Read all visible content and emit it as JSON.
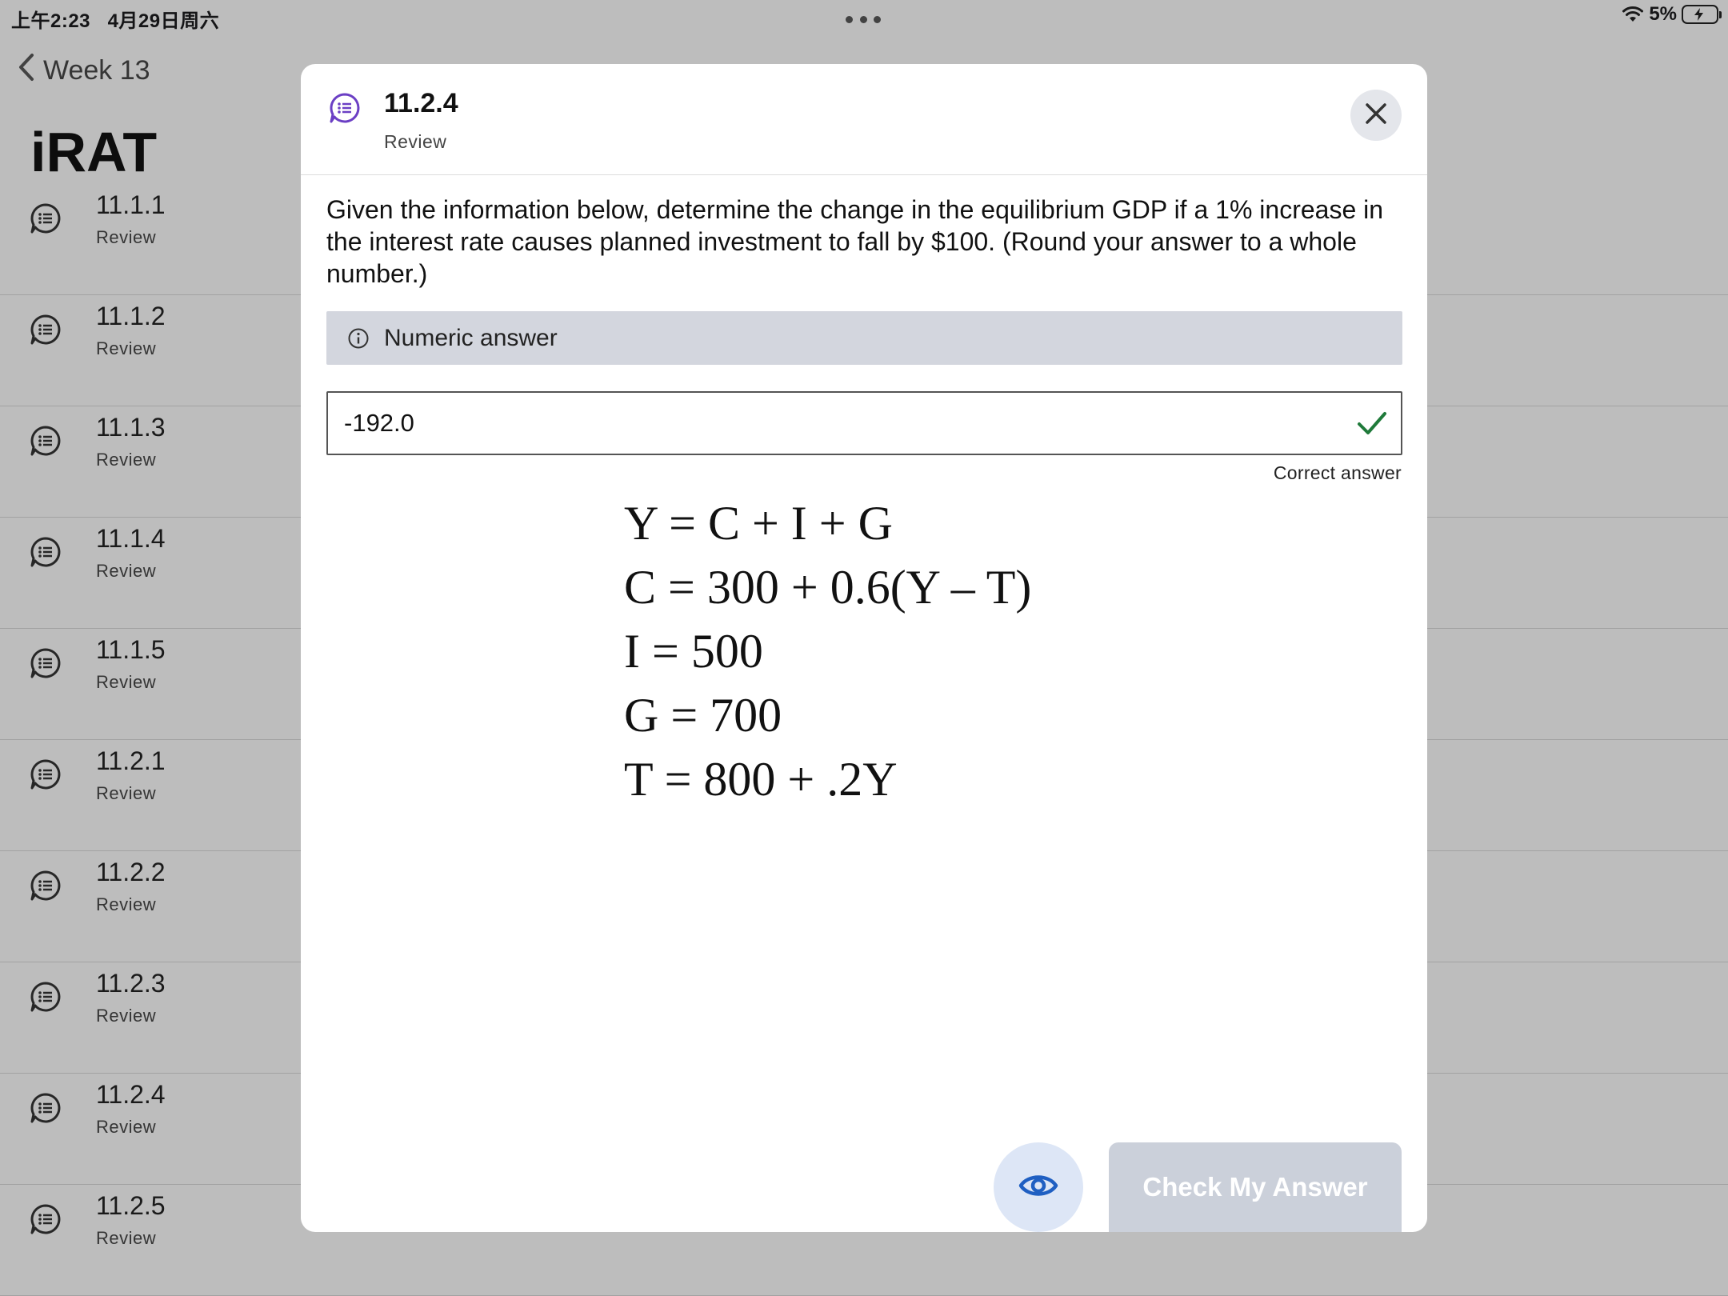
{
  "status_bar": {
    "time": "上午2:23",
    "date": "4月29日周六",
    "battery": "5%"
  },
  "nav": {
    "back_label": "Week 13",
    "page_title": "iRAT"
  },
  "list": {
    "items": [
      {
        "title": "11.1.1",
        "subtitle": "Review"
      },
      {
        "title": "11.1.2",
        "subtitle": "Review"
      },
      {
        "title": "11.1.3",
        "subtitle": "Review"
      },
      {
        "title": "11.1.4",
        "subtitle": "Review"
      },
      {
        "title": "11.1.5",
        "subtitle": "Review"
      },
      {
        "title": "11.2.1",
        "subtitle": "Review"
      },
      {
        "title": "11.2.2",
        "subtitle": "Review"
      },
      {
        "title": "11.2.3",
        "subtitle": "Review"
      },
      {
        "title": "11.2.4",
        "subtitle": "Review"
      },
      {
        "title": "11.2.5",
        "subtitle": "Review"
      }
    ]
  },
  "modal": {
    "title": "11.2.4",
    "subtitle": "Review",
    "question": "Given the information below, determine the change in the equilibrium GDP if a 1% increase in the interest rate causes planned investment to fall by $100.  (Round your answer to a whole number.)",
    "answer_type_label": "Numeric answer",
    "answer_value": "-192.0",
    "feedback": "Correct answer",
    "equations": [
      "Y = C + I + G",
      "C = 300 + 0.6(Y – T)",
      "I = 500",
      "G = 700",
      "T = 800 + .2Y"
    ],
    "check_button_label": "Check My Answer"
  },
  "colors": {
    "accent_purple": "#6b3fc4",
    "correct_green": "#1f7a3a",
    "reveal_blue": "#1f5fc2"
  }
}
